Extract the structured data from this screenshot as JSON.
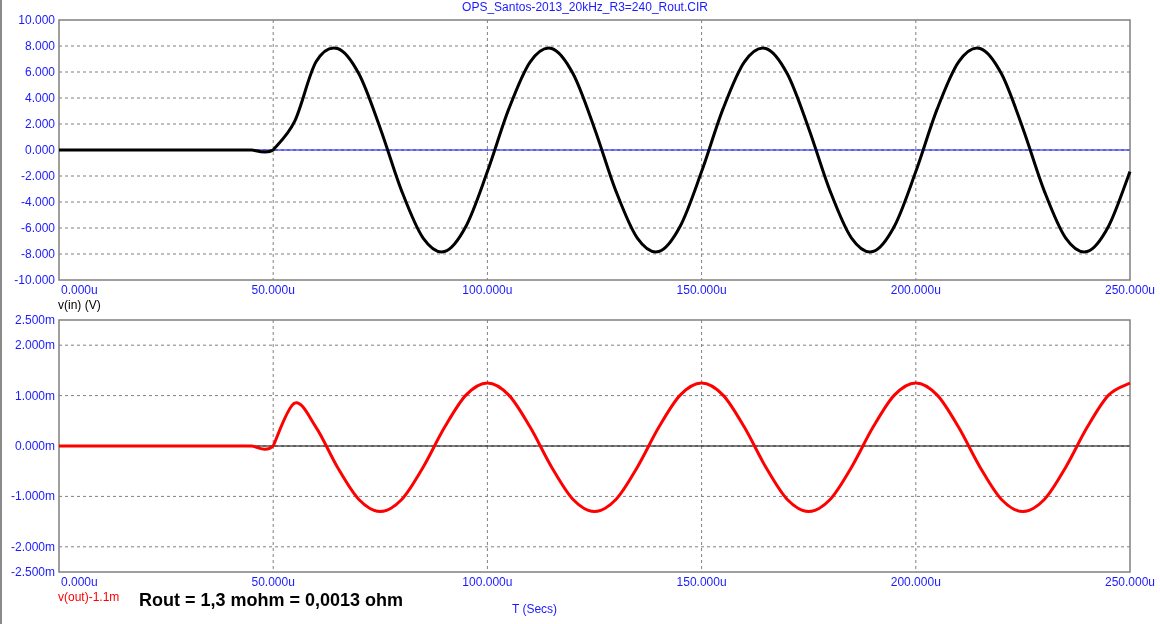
{
  "window": {
    "title": "OPS_Santos-2013_20kHz_R3=240_Rout.CIR"
  },
  "plots": [
    {
      "chart_data": {
        "type": "line",
        "grid": true,
        "ref_lines": [
          {
            "axis": "y",
            "value": 0,
            "color": "#0000ff"
          }
        ],
        "xlim": [
          0,
          250
        ],
        "ylim": [
          -10,
          10
        ],
        "xticks": [
          {
            "value": 0,
            "label": "0.000u"
          },
          {
            "value": 50,
            "label": "50.000u"
          },
          {
            "value": 100,
            "label": "100.000u"
          },
          {
            "value": 150,
            "label": "150.000u"
          },
          {
            "value": 200,
            "label": "200.000u"
          },
          {
            "value": 250,
            "label": "250.000u"
          }
        ],
        "yticks": [
          {
            "value": 10,
            "label": "10.000"
          },
          {
            "value": 8,
            "label": "8.000"
          },
          {
            "value": 6,
            "label": "6.000"
          },
          {
            "value": 4,
            "label": "4.000"
          },
          {
            "value": 2,
            "label": "2.000"
          },
          {
            "value": 0,
            "label": "0.000"
          },
          {
            "value": -2,
            "label": "-2.000"
          },
          {
            "value": -4,
            "label": "-4.000"
          },
          {
            "value": -6,
            "label": "-6.000"
          },
          {
            "value": -8,
            "label": "-8.000"
          },
          {
            "value": -10,
            "label": "-10.000"
          }
        ],
        "x": [
          0,
          5,
          10,
          15,
          20,
          25,
          30,
          35,
          40,
          45,
          50,
          55,
          60,
          65,
          70,
          75,
          80,
          85,
          90,
          95,
          100,
          105,
          110,
          115,
          120,
          125,
          130,
          135,
          140,
          145,
          150,
          155,
          160,
          165,
          170,
          175,
          180,
          185,
          190,
          195,
          200,
          205,
          210,
          215,
          220,
          225,
          230,
          235,
          240,
          245,
          250
        ],
        "series": [
          {
            "name": "v(in) (V)",
            "color": "#000000",
            "values": [
              0,
              0,
              0,
              0,
              0,
              0,
              0,
              0,
              0,
              0,
              0,
              2.2,
              6.78,
              7.81,
              5.86,
              1.66,
              -3.16,
              -6.78,
              -7.81,
              -5.86,
              -1.66,
              3.16,
              6.78,
              7.81,
              5.86,
              1.66,
              -3.16,
              -6.78,
              -7.81,
              -5.86,
              -1.66,
              3.16,
              6.78,
              7.81,
              5.86,
              1.66,
              -3.16,
              -6.78,
              -7.81,
              -5.86,
              -1.66,
              3.16,
              6.78,
              7.81,
              5.86,
              1.66,
              -3.16,
              -6.78,
              -7.81,
              -5.86,
              -1.66
            ]
          }
        ]
      }
    },
    {
      "chart_data": {
        "type": "line",
        "grid": true,
        "ref_lines": [
          {
            "axis": "y",
            "value": 0,
            "color": "#000000"
          }
        ],
        "xlabel": "T (Secs)",
        "xlim": [
          0,
          250
        ],
        "ylim": [
          -2.5,
          2.5
        ],
        "xticks": [
          {
            "value": 0,
            "label": "0.000u"
          },
          {
            "value": 50,
            "label": "50.000u"
          },
          {
            "value": 100,
            "label": "100.000u"
          },
          {
            "value": 150,
            "label": "150.000u"
          },
          {
            "value": 200,
            "label": "200.000u"
          },
          {
            "value": 250,
            "label": "250.000u"
          }
        ],
        "yticks": [
          {
            "value": 2.5,
            "label": "2.500m"
          },
          {
            "value": 2,
            "label": "2.000m"
          },
          {
            "value": 1,
            "label": "1.000m"
          },
          {
            "value": 0,
            "label": "0.000m"
          },
          {
            "value": -1,
            "label": "-1.000m"
          },
          {
            "value": -2,
            "label": "-2.000m"
          },
          {
            "value": -2.5,
            "label": "-2.500m"
          }
        ],
        "x": [
          0,
          5,
          10,
          15,
          20,
          25,
          30,
          35,
          40,
          45,
          50,
          55,
          60,
          65,
          70,
          75,
          80,
          85,
          90,
          95,
          100,
          105,
          110,
          115,
          120,
          125,
          130,
          135,
          140,
          145,
          150,
          155,
          160,
          165,
          170,
          175,
          180,
          185,
          190,
          195,
          200,
          205,
          210,
          215,
          220,
          225,
          230,
          235,
          240,
          245,
          250
        ],
        "series": [
          {
            "name": "v(out)-1.1m",
            "color": "#ff0000",
            "values": [
              0,
              0,
              0,
              0,
              0,
              0,
              0,
              0,
              0,
              0,
              0,
              0.85,
              0.37,
              -0.42,
              -1.06,
              -1.3,
              -1.06,
              -0.42,
              0.37,
              1.01,
              1.25,
              1.01,
              0.37,
              -0.42,
              -1.06,
              -1.3,
              -1.06,
              -0.42,
              0.37,
              1.01,
              1.25,
              1.01,
              0.37,
              -0.42,
              -1.06,
              -1.3,
              -1.06,
              -0.42,
              0.37,
              1.01,
              1.25,
              1.01,
              0.37,
              -0.42,
              -1.06,
              -1.3,
              -1.06,
              -0.42,
              0.37,
              1.01,
              1.25
            ]
          }
        ]
      }
    }
  ],
  "note": "Rout = 1,3 mohm = 0,0013 ohm"
}
